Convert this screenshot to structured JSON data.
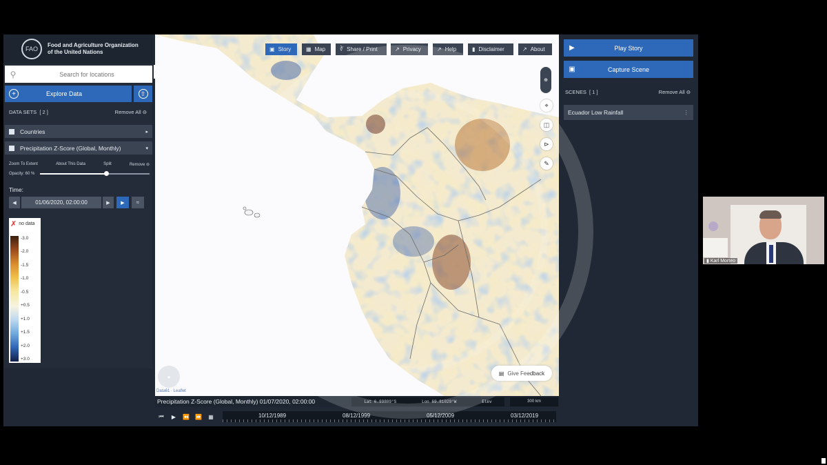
{
  "header": {
    "org_line1": "Food and Agriculture Organization",
    "org_line2": "of the United Nations",
    "logo_text": "FAO"
  },
  "search": {
    "placeholder": "Search for locations"
  },
  "explore_label": "Explore Data",
  "datasets": {
    "title": "DATA SETS",
    "count": "[ 2 ]",
    "remove_all": "Remove All"
  },
  "layers": [
    {
      "label": "Countries"
    },
    {
      "label": "Precipitation Z-Score (Global, Monthly)"
    }
  ],
  "layer_controls": {
    "zoom": "Zoom To Extent",
    "about": "About This Data",
    "split": "Split",
    "remove": "Remove",
    "opacity": "Opacity: 60 %",
    "opacity_value": 0.6
  },
  "time": {
    "label": "Time:",
    "value": "01/06/2020, 02:00:00"
  },
  "legend": {
    "no_data": "no data",
    "labels": [
      "-3.0",
      "-2.0",
      "-1.5",
      "-1.0",
      "-0.5",
      "+0.5",
      "+1.0",
      "+1.5",
      "+2.0",
      "+3.0"
    ],
    "colors": [
      "#3a1f0e",
      "#9a4a1b",
      "#d98b2e",
      "#f0c04a",
      "#f7e7a0",
      "#f6f3e0",
      "#bcd8f0",
      "#6ea8dc",
      "#2f64b4",
      "#141f4a"
    ]
  },
  "toolbar": [
    {
      "label": "Story",
      "icon": "story-icon",
      "active": true
    },
    {
      "label": "Map",
      "icon": "map-icon",
      "active": false
    },
    {
      "label": "Share / Print",
      "icon": "share-icon",
      "active": false
    },
    {
      "label": "Privacy",
      "icon": "external-link-icon",
      "active": false
    },
    {
      "label": "Help",
      "icon": "external-link-icon",
      "active": false
    },
    {
      "label": "Disclaimer",
      "icon": "disclaimer-icon",
      "active": false
    },
    {
      "label": "About",
      "icon": "external-link-icon",
      "active": false
    }
  ],
  "map": {
    "feedback": "Give Feedback",
    "attribution": "Data61 · Leaflet",
    "info_title": "Precipitation Z-Score (Global, Monthly) 01/07/2020, 02:00:00",
    "lat": "Lat 6.99809°S",
    "lon": "Lon 69.81029°W",
    "elev": "Elev",
    "scale": "300 km"
  },
  "timeline": {
    "dates": [
      "10/12/1989",
      "08/12/1999",
      "05/12/2009",
      "03/12/2019"
    ]
  },
  "right": {
    "play_story": "Play Story",
    "capture_scene": "Capture Scene",
    "scenes_title": "SCENES",
    "scenes_count": "[ 1 ]",
    "remove_all": "Remove All",
    "scenes": [
      {
        "label": "Ecuador Low Rainfall"
      }
    ]
  },
  "video": {
    "name": "Karl Morteo"
  },
  "colors": {
    "accent": "#2e68b8",
    "panel": "#1f2834",
    "panel_item": "#3a4452"
  }
}
